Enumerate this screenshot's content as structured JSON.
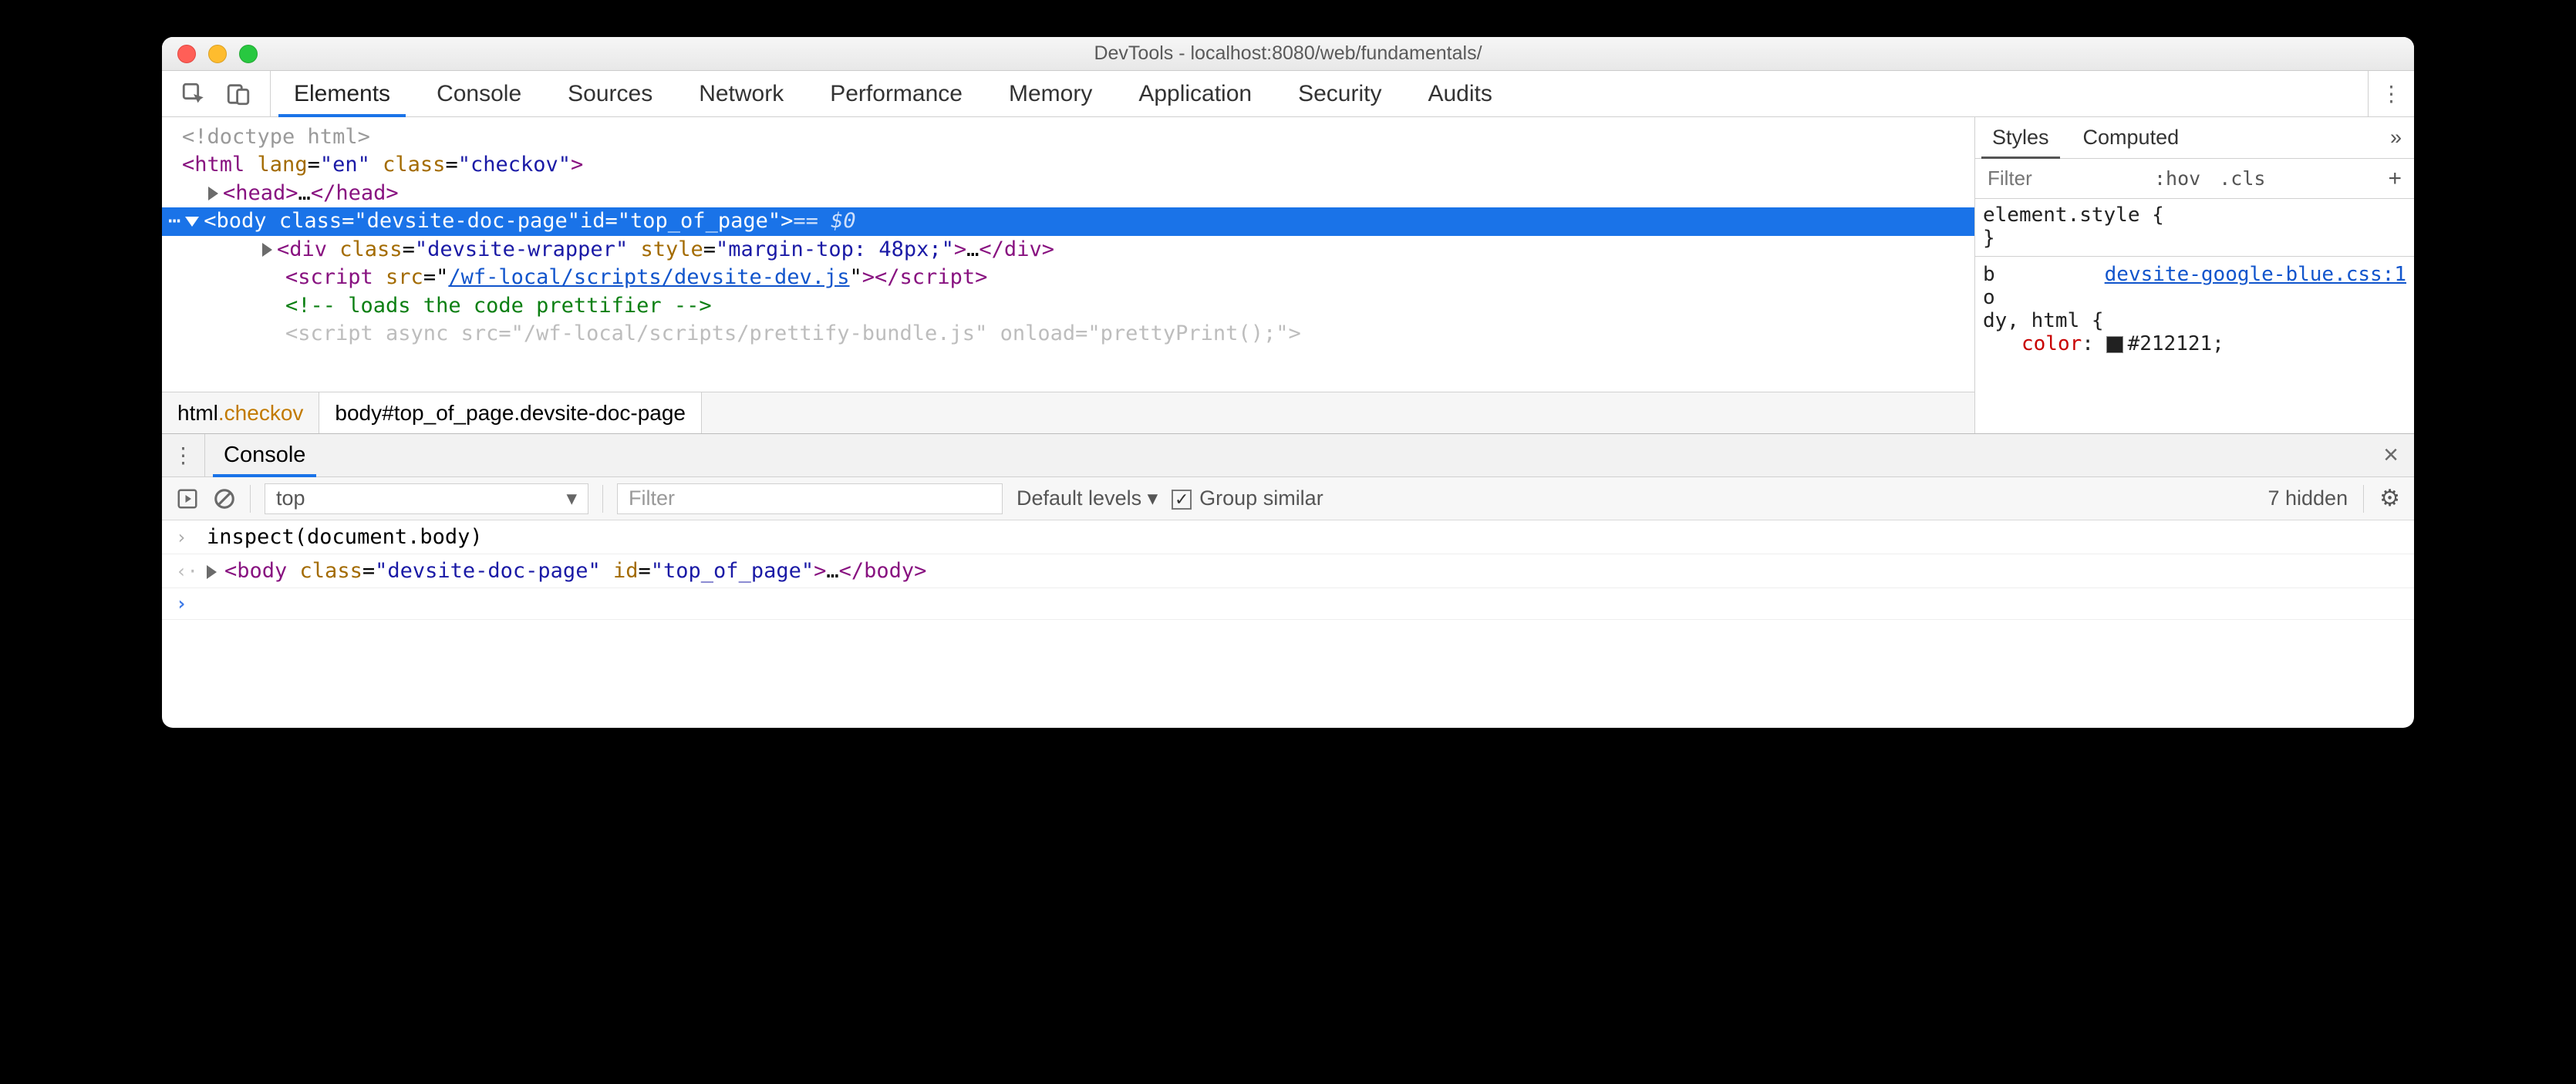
{
  "window": {
    "title": "DevTools - localhost:8080/web/fundamentals/"
  },
  "tabs": {
    "items": [
      "Elements",
      "Console",
      "Sources",
      "Network",
      "Performance",
      "Memory",
      "Application",
      "Security",
      "Audits"
    ],
    "active": "Elements"
  },
  "dom": {
    "doctype": "<!doctype html>",
    "html_open": {
      "lang": "en",
      "class": "checkov"
    },
    "head": "<head>…</head>",
    "body_sel": {
      "class": "devsite-doc-page",
      "id": "top_of_page",
      "suffix": "== $0"
    },
    "wrapper": {
      "class": "devsite-wrapper",
      "style": "margin-top: 48px;"
    },
    "script1_src": "/wf-local/scripts/devsite-dev.js",
    "comment": "<!-- loads the code prettifier -->",
    "script2": {
      "src": "/wf-local/scripts/prettify-bundle.js",
      "onload": "prettyPrint();"
    }
  },
  "breadcrumb": {
    "a": {
      "tag": "html",
      "cls": ".checkov"
    },
    "b": "body#top_of_page.devsite-doc-page"
  },
  "styles": {
    "tabs": [
      "Styles",
      "Computed"
    ],
    "more": "»",
    "filter_placeholder": "Filter",
    "hov": ":hov",
    "cls": ".cls",
    "rule1": "element.style {",
    "rule1b": "}",
    "src": "devsite-google-blue.css:1",
    "sel_lines": [
      "b",
      "o",
      "dy, html {"
    ],
    "prop": "color",
    "val": "#212121"
  },
  "drawer": {
    "tab": "Console",
    "context": "top",
    "filter_placeholder": "Filter",
    "levels": "Default levels",
    "group": "Group similar",
    "hidden": "7 hidden"
  },
  "console": {
    "in": "inspect(document.body)",
    "out": {
      "class": "devsite-doc-page",
      "id": "top_of_page"
    }
  }
}
